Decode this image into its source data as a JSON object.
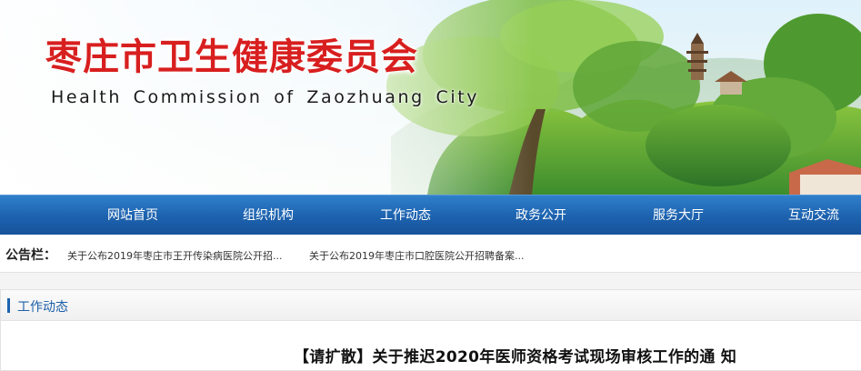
{
  "header": {
    "title_cn": "枣庄市卫生健康委员会",
    "title_en": "Health Commission of Zaozhuang City"
  },
  "nav": {
    "items": [
      {
        "label": "网站首页"
      },
      {
        "label": "组织机构"
      },
      {
        "label": "工作动态"
      },
      {
        "label": "政务公开"
      },
      {
        "label": "服务大厅"
      },
      {
        "label": "互动交流"
      }
    ]
  },
  "notice": {
    "label": "公告栏：",
    "items": [
      {
        "text": "关于公布2019年枣庄市王开传染病医院公开招..."
      },
      {
        "text": "关于公布2019年枣庄市口腔医院公开招聘备案..."
      }
    ]
  },
  "section": {
    "title": "工作动态"
  },
  "article": {
    "title": "【请扩散】关于推迟2020年医师资格考试现场审核工作的通 知"
  },
  "colors": {
    "title_red": "#d81f1f",
    "nav_blue": "#1d62ae",
    "section_blue": "#1d5fa8"
  }
}
